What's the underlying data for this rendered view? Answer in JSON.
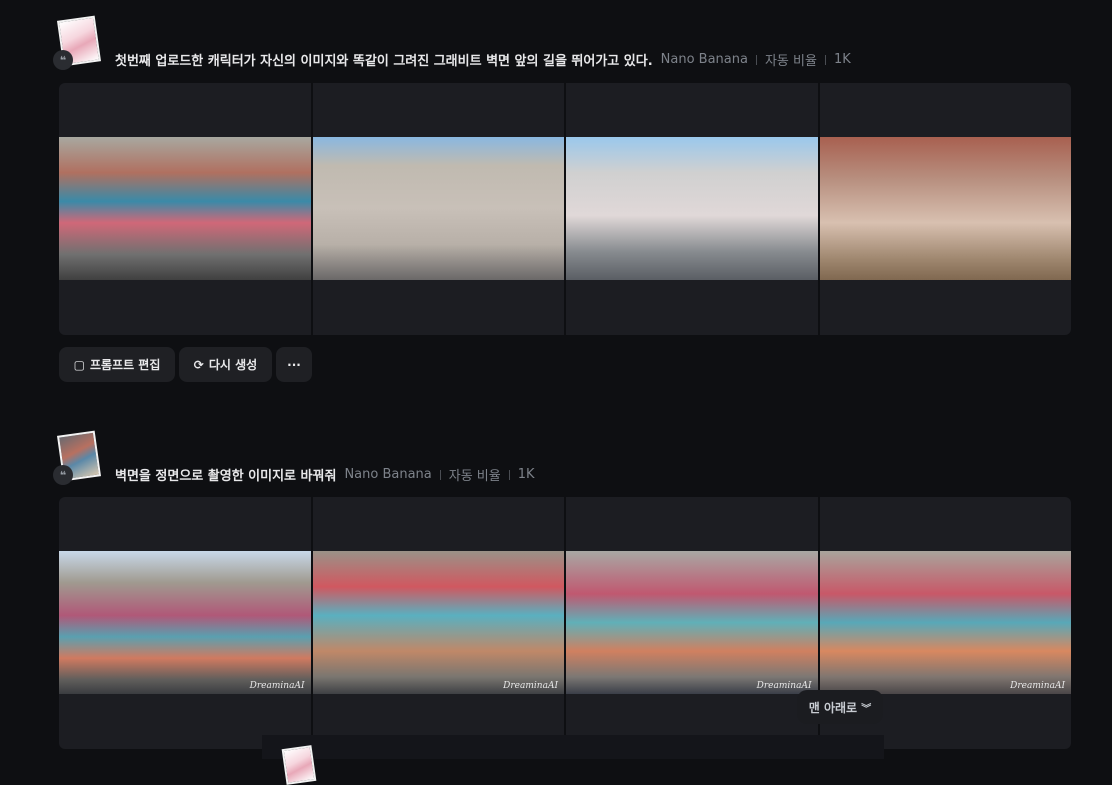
{
  "generations": [
    {
      "prompt": "첫번째 업로드한 캐릭터가 자신의 이미지와 똑같이 그려진 그래비트 벽면 앞의 길을 뛰어가고 있다.",
      "model": "Nano Banana",
      "ratio": "자동 비율",
      "resolution": "1K"
    },
    {
      "prompt": "벽면을 정면으로 촬영한 이미지로 바꿔줘",
      "model": "Nano Banana",
      "ratio": "자동 비율",
      "resolution": "1K",
      "watermark": "DreaminaAI"
    }
  ],
  "actions": {
    "edit_prompt": "프롬프트 편집",
    "regenerate": "다시 생성",
    "more": "···"
  },
  "scroll_bottom": "맨 아래로",
  "quote_glyph": "❝"
}
